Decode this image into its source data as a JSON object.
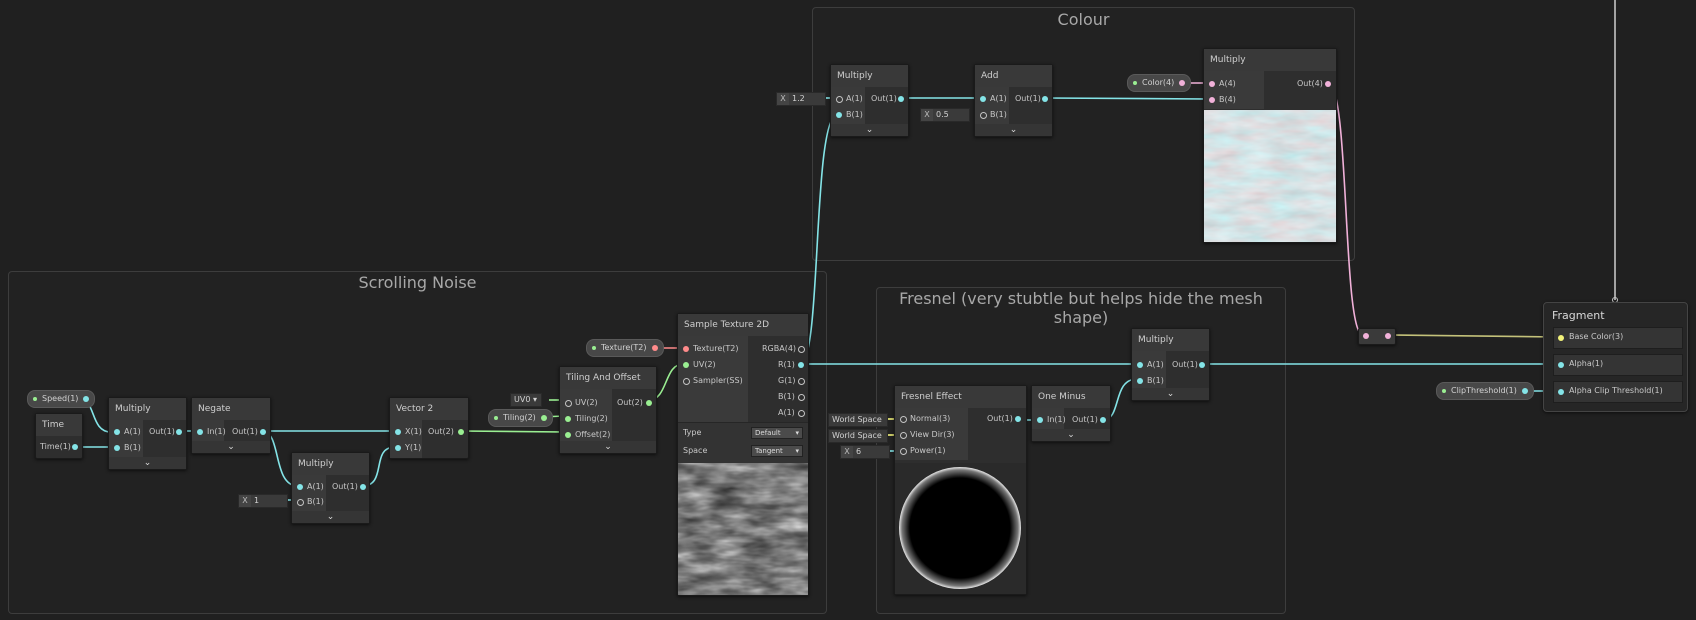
{
  "groups": {
    "colour": {
      "title": "Colour"
    },
    "scrolling_noise": {
      "title": "Scrolling Noise"
    },
    "fresnel": {
      "title": "Fresnel (very stubtle but helps hide the mesh shape)"
    }
  },
  "properties": {
    "speed": "Speed(1)",
    "tiling": "Tiling(2)",
    "texture": "Texture(T2)",
    "color": "Color(4)",
    "clip_threshold": "ClipThreshold(1)"
  },
  "nodes": {
    "time": {
      "title": "Time",
      "out": "Time(1)"
    },
    "multiply_speed": {
      "title": "Multiply",
      "a": "A(1)",
      "b": "B(1)",
      "out": "Out(1)"
    },
    "negate": {
      "title": "Negate",
      "in": "In(1)",
      "out": "Out(1)"
    },
    "multiply_one": {
      "title": "Multiply",
      "a": "A(1)",
      "b": "B(1)",
      "out": "Out(1)",
      "b_label": "X",
      "b_value": "1"
    },
    "vector2": {
      "title": "Vector 2",
      "x": "X(1)",
      "y": "Y(1)",
      "out": "Out(2)"
    },
    "tiling_offset": {
      "title": "Tiling And Offset",
      "uv": "UV(2)",
      "tiling": "Tiling(2)",
      "offset": "Offset(2)",
      "out": "Out(2)",
      "uv_channel": "UV0"
    },
    "sample_texture": {
      "title": "Sample Texture 2D",
      "texture": "Texture(T2)",
      "uv": "UV(2)",
      "sampler": "Sampler(SS)",
      "rgba": "RGBA(4)",
      "r": "R(1)",
      "g": "G(1)",
      "b": "B(1)",
      "a": "A(1)",
      "type_label": "Type",
      "type_value": "Default",
      "space_label": "Space",
      "space_value": "Tangent"
    },
    "multiply_scale": {
      "title": "Multiply",
      "a": "A(1)",
      "b": "B(1)",
      "out": "Out(1)",
      "a_label": "X",
      "a_value": "1.2"
    },
    "add": {
      "title": "Add",
      "a": "A(1)",
      "b": "B(1)",
      "out": "Out(1)",
      "b_label": "X",
      "b_value": "0.5"
    },
    "multiply_color": {
      "title": "Multiply",
      "a": "A(4)",
      "b": "B(4)",
      "out": "Out(4)"
    },
    "fresnel": {
      "title": "Fresnel Effect",
      "normal": "Normal(3)",
      "view_dir": "View Dir(3)",
      "power": "Power(1)",
      "out": "Out(1)",
      "normal_space": "World Space",
      "view_space": "World Space",
      "power_label": "X",
      "power_value": "6"
    },
    "one_minus": {
      "title": "One Minus",
      "in": "In(1)",
      "out": "Out(1)"
    },
    "multiply_fresnel": {
      "title": "Multiply",
      "a": "A(1)",
      "b": "B(1)",
      "out": "Out(1)"
    },
    "fragment": {
      "title": "Fragment",
      "base_color": "Base Color(3)",
      "alpha": "Alpha(1)",
      "alpha_clip": "Alpha Clip Threshold(1)"
    }
  },
  "colors": {
    "background": "#202020",
    "float_port": "#84e4e7",
    "vector2_port": "#9aef92",
    "vector4_port": "#f1b1d9",
    "texture_port": "#ff8b8b",
    "vector3_port": "#f2f27a"
  }
}
